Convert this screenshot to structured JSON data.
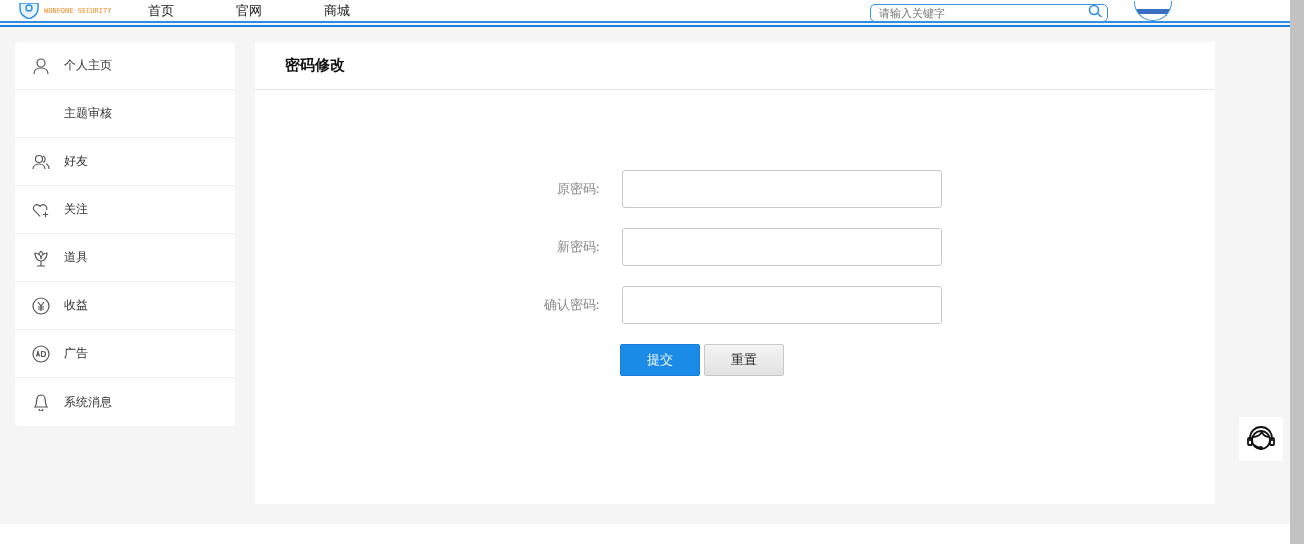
{
  "header": {
    "logo_subtitle": "WONFONE SECURITY",
    "nav": [
      "首页",
      "官网",
      "商城"
    ],
    "search": {
      "placeholder": "请输入关键字"
    }
  },
  "sidebar": {
    "items": [
      {
        "label": "个人主页"
      },
      {
        "label": "主题审核"
      },
      {
        "label": "好友"
      },
      {
        "label": "关注"
      },
      {
        "label": "道具"
      },
      {
        "label": "收益"
      },
      {
        "label": "广告"
      },
      {
        "label": "系统消息"
      }
    ]
  },
  "panel": {
    "title": "密码修改",
    "fields": [
      {
        "label": "原密码:"
      },
      {
        "label": "新密码:"
      },
      {
        "label": "确认密码:"
      }
    ],
    "buttons": [
      {
        "label": "提交",
        "kind": "primary"
      },
      {
        "label": "重置",
        "kind": "secondary"
      }
    ]
  }
}
